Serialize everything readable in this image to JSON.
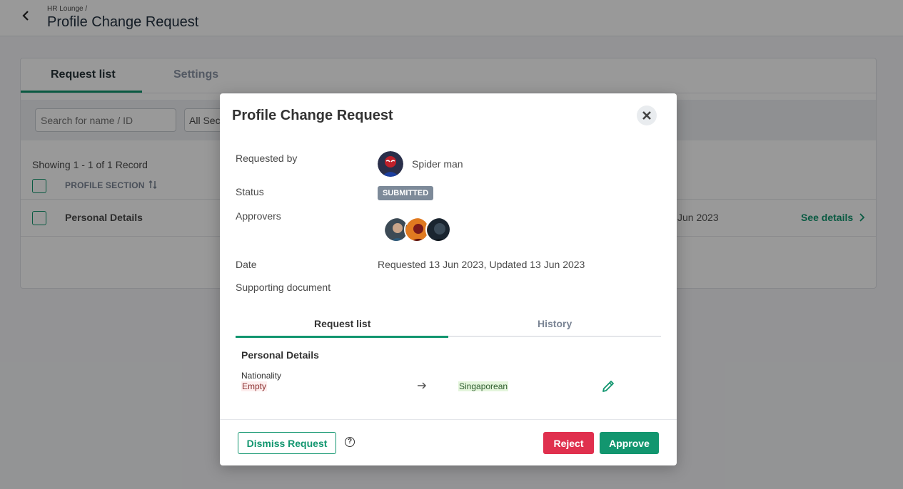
{
  "header": {
    "breadcrumb": "HR Lounge /",
    "title": "Profile Change Request"
  },
  "background": {
    "tabs": [
      {
        "label": "Request list"
      },
      {
        "label": "Settings"
      }
    ],
    "search_placeholder": "Search for name / ID",
    "section_select": "All Sec",
    "showing": "Showing 1 - 1 of 1 Record",
    "column_header": "PROFILE SECTION",
    "rows": [
      {
        "name": "Personal Details",
        "date": "Jun 2023",
        "action": "See details"
      }
    ]
  },
  "modal": {
    "title": "Profile Change Request",
    "labels": {
      "requested_by": "Requested by",
      "status": "Status",
      "approvers": "Approvers",
      "date": "Date",
      "supporting_document": "Supporting document"
    },
    "requester_name": "Spider man",
    "status": "SUBMITTED",
    "date_text": "Requested 13 Jun 2023, Updated 13 Jun 2023",
    "tabs": [
      {
        "label": "Request list"
      },
      {
        "label": "History"
      }
    ],
    "section_title": "Personal Details",
    "change": {
      "field": "Nationality",
      "old_value": "Empty",
      "new_value": "Singaporean"
    },
    "buttons": {
      "dismiss": "Dismiss Request",
      "help": "?",
      "reject": "Reject",
      "approve": "Approve"
    }
  },
  "colors": {
    "accent": "#12966f",
    "danger": "#e0304e",
    "badge": "#7d8a99"
  }
}
